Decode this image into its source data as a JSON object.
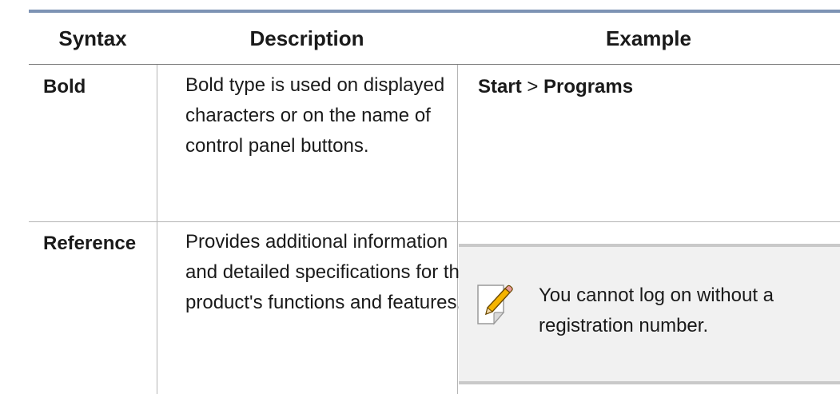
{
  "table": {
    "headers": {
      "syntax": "Syntax",
      "description": "Description",
      "example": "Example"
    },
    "rows": [
      {
        "syntax": "Bold",
        "description": "Bold type is used on displayed characters or on the name of control panel buttons.",
        "example": {
          "part1": "Start",
          "separator": " > ",
          "part2": "Programs"
        }
      },
      {
        "syntax": "Reference",
        "description": "Provides additional information and detailed specifications for the product's functions and features.",
        "example": {
          "note_icon": "note-pencil-icon",
          "note_text": "You cannot log on without a registration number."
        }
      }
    ]
  },
  "colors": {
    "top_rule": "#7d93b4",
    "note_background": "#f1f1f1",
    "note_border": "#c9c9c9",
    "pencil_accent": "#f5b400"
  }
}
